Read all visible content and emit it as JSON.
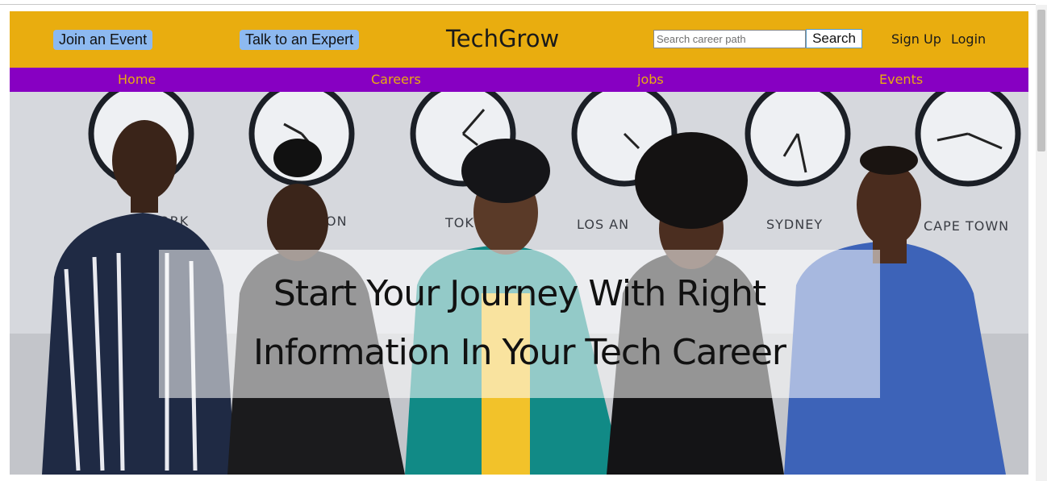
{
  "header": {
    "join_event_label": "Join an Event",
    "talk_expert_label": "Talk to an Expert",
    "brand": "TechGrow",
    "search": {
      "placeholder": "Search career path",
      "value": "",
      "button_label": "Search"
    },
    "signup_label": "Sign Up",
    "login_label": "Login"
  },
  "nav": {
    "items": [
      {
        "label": "Home"
      },
      {
        "label": "Careers"
      },
      {
        "label": "jobs"
      },
      {
        "label": "Events"
      }
    ]
  },
  "hero": {
    "headline_line1": "Start Your Journey With Right",
    "headline_line2": "Information In Your Tech Career",
    "clock_labels": [
      "ORK",
      "ON",
      "TOK",
      "LOS AN",
      "SYDNEY",
      "CAPE TOWN"
    ]
  },
  "colors": {
    "header_bg": "#e9ad0f",
    "nav_bg": "#8700c2",
    "nav_text": "#e9ad0f",
    "pill_button": "#8db9f0"
  }
}
